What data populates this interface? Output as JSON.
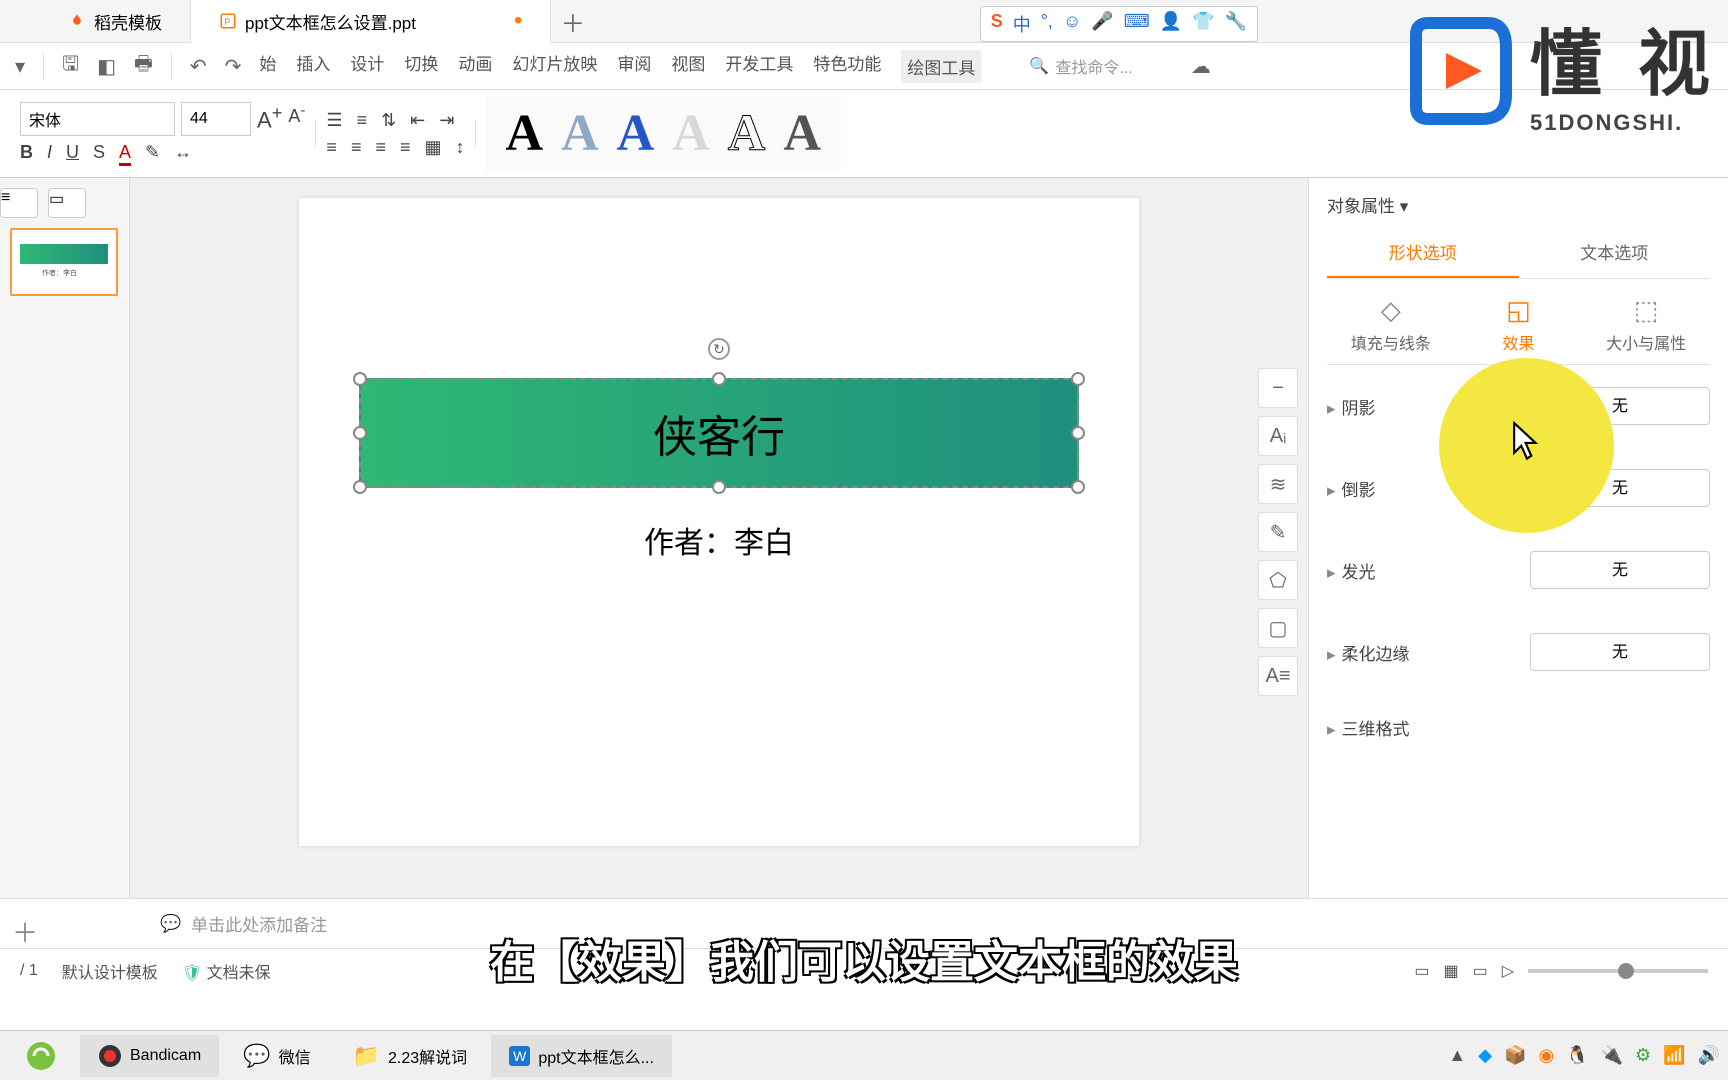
{
  "tabs": {
    "tab1": "稻壳模板",
    "tab2": "ppt文本框怎么设置.ppt"
  },
  "menu": {
    "start": "始",
    "insert": "插入",
    "design": "设计",
    "transition": "切换",
    "animation": "动画",
    "slideshow": "幻灯片放映",
    "review": "审阅",
    "view": "视图",
    "dev": "开发工具",
    "special": "特色功能",
    "draw": "绘图工具",
    "search_ph": "查找命令..."
  },
  "font": {
    "name": "宋体",
    "size": "44"
  },
  "slide": {
    "title": "侠客行",
    "subtitle": "作者：李白"
  },
  "panel": {
    "title": "对象属性",
    "tab_shape": "形状选项",
    "tab_text": "文本选项",
    "sub_fill": "填充与线条",
    "sub_effect": "效果",
    "sub_size": "大小与属性",
    "shadow": "阴影",
    "reflection": "倒影",
    "glow": "发光",
    "soft": "柔化边缘",
    "three_d": "三维格式",
    "none": "无"
  },
  "notes": "单击此处添加备注",
  "status": {
    "page": "/ 1",
    "template": "默认设计模板",
    "doc": "文档未保"
  },
  "caption": "在【效果】我们可以设置文本框的效果",
  "taskbar": {
    "bandicam": "Bandicam",
    "wechat": "微信",
    "folder": "2.23解说词",
    "wps": "ppt文本框怎么..."
  },
  "logo": {
    "text": "懂 视",
    "sub": "51DONGSHI."
  },
  "ime": "中"
}
